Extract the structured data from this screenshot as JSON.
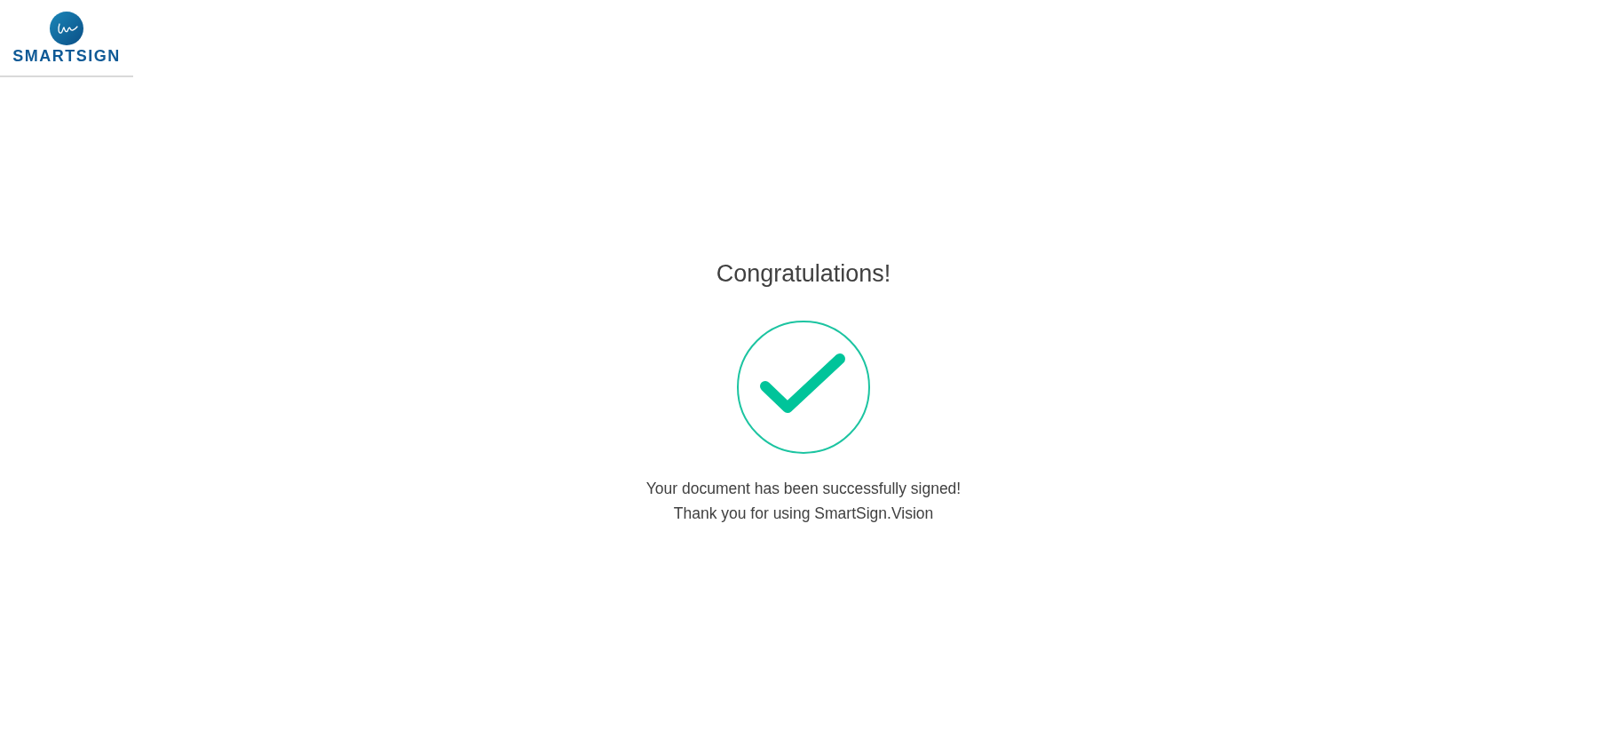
{
  "header": {
    "logo_text": "SMARTSIGN"
  },
  "title": "Congratulations!",
  "message_lines": [
    "Your document has been successfully signed!",
    "Thank you for using SmartSign.Vision"
  ]
}
